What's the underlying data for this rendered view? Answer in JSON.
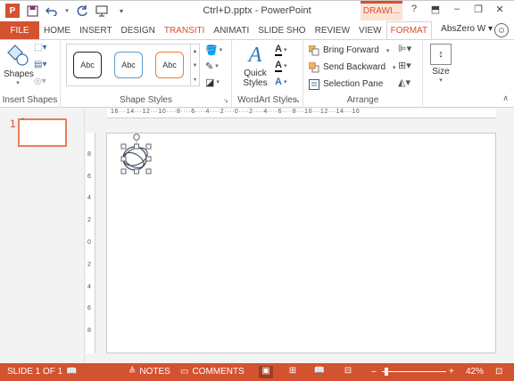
{
  "window": {
    "title": "Ctrl+D.pptx - PowerPoint",
    "context_tab": "DRAWI...",
    "help": "?",
    "minimize": "–",
    "restore": "❐",
    "close": "✕"
  },
  "qat": [
    "save-icon",
    "undo-icon",
    "redo-icon",
    "present-icon",
    "customize-icon"
  ],
  "tabs": [
    {
      "label": "FILE"
    },
    {
      "label": "HOME"
    },
    {
      "label": "INSERT"
    },
    {
      "label": "DESIGN"
    },
    {
      "label": "TRANSITI"
    },
    {
      "label": "ANIMATI"
    },
    {
      "label": "SLIDE SHO"
    },
    {
      "label": "REVIEW"
    },
    {
      "label": "VIEW"
    },
    {
      "label": "FORMAT"
    }
  ],
  "account": {
    "name": "AbsZero W",
    "arrow": "▾",
    "smiley": "⌣"
  },
  "ribbon": {
    "insert_shapes": {
      "shapes_label": "Shapes",
      "group_label": "Insert Shapes"
    },
    "shape_styles": {
      "swatches": [
        "Abc",
        "Abc",
        "Abc"
      ],
      "group_label": "Shape Styles",
      "fill_icon": "fill-bucket-icon",
      "outline_icon": "outline-pen-icon",
      "effects_icon": "effects-icon"
    },
    "wordart": {
      "quick_label_1": "Quick",
      "quick_label_2": "Styles",
      "group_label": "WordArt Styles",
      "text_fill": "A",
      "text_outline": "A",
      "text_effects": "A"
    },
    "arrange": {
      "bring_forward": "Bring Forward",
      "send_backward": "Send Backward",
      "selection_pane": "Selection Pane",
      "group_label": "Arrange"
    },
    "size": {
      "label": "Size"
    }
  },
  "slides_pane": {
    "number": "1",
    "star": "*"
  },
  "ruler": {
    "h_text": "16···14···12···10····8····6····4····2····0····2····4····6····8···10···12···14···16",
    "v_marks": [
      "8",
      "6",
      "4",
      "2",
      "0",
      "2",
      "4",
      "6",
      "8"
    ]
  },
  "status": {
    "slide_info": "SLIDE 1 OF 1",
    "notes": "NOTES",
    "comments": "COMMENTS",
    "zoom_minus": "–",
    "zoom_plus": "+",
    "zoom": "42%",
    "zoom_level": 0.42
  },
  "colors": {
    "accent": "#d35230",
    "blue": "#2e75b6"
  }
}
